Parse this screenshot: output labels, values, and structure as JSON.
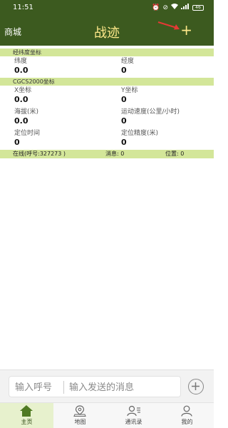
{
  "status_bar": {
    "time": "11:51",
    "icons": [
      "alarm-icon",
      "mute-icon",
      "wifi-icon",
      "signal-icon",
      "battery-icon"
    ],
    "battery": "46"
  },
  "app_bar": {
    "store_label": "商城",
    "title": "战迹",
    "add_symbol": "+"
  },
  "sections": {
    "latlon": {
      "title": "经纬度坐标",
      "latitude": {
        "label": "纬度",
        "value": "0.0"
      },
      "longitude": {
        "label": "经度",
        "value": "0"
      }
    },
    "cgcs": {
      "title": "CGCS2000坐标",
      "x": {
        "label": "X坐标",
        "value": "0.0"
      },
      "y": {
        "label": "Y坐标",
        "value": "0"
      },
      "altitude": {
        "label": "海拔(米)",
        "value": "0.0"
      },
      "speed": {
        "label": "运动速度(公里/小时)",
        "value": "0"
      },
      "fix_time": {
        "label": "定位时间",
        "value": "0"
      },
      "accuracy": {
        "label": "定位精度(米)",
        "value": "0"
      }
    }
  },
  "online_bar": {
    "online": "在线(呼号:327273 )",
    "messages": "消息: 0",
    "position": "位置: 0"
  },
  "input_bar": {
    "callsign_placeholder": "输入呼号",
    "message_placeholder": "输入发送的消息"
  },
  "tab_bar": {
    "tabs": [
      {
        "label": "主页",
        "icon": "home-icon",
        "active": true
      },
      {
        "label": "地图",
        "icon": "map-pin-icon",
        "active": false
      },
      {
        "label": "通讯录",
        "icon": "contacts-icon",
        "active": false
      },
      {
        "label": "我的",
        "icon": "user-icon",
        "active": false
      }
    ]
  },
  "colors": {
    "app_bar": "#3c5a1f",
    "title": "#ffe98a",
    "section_bg": "#d3e699",
    "active_tab": "#e7f1cd",
    "annotation_arrow": "#e53935"
  }
}
